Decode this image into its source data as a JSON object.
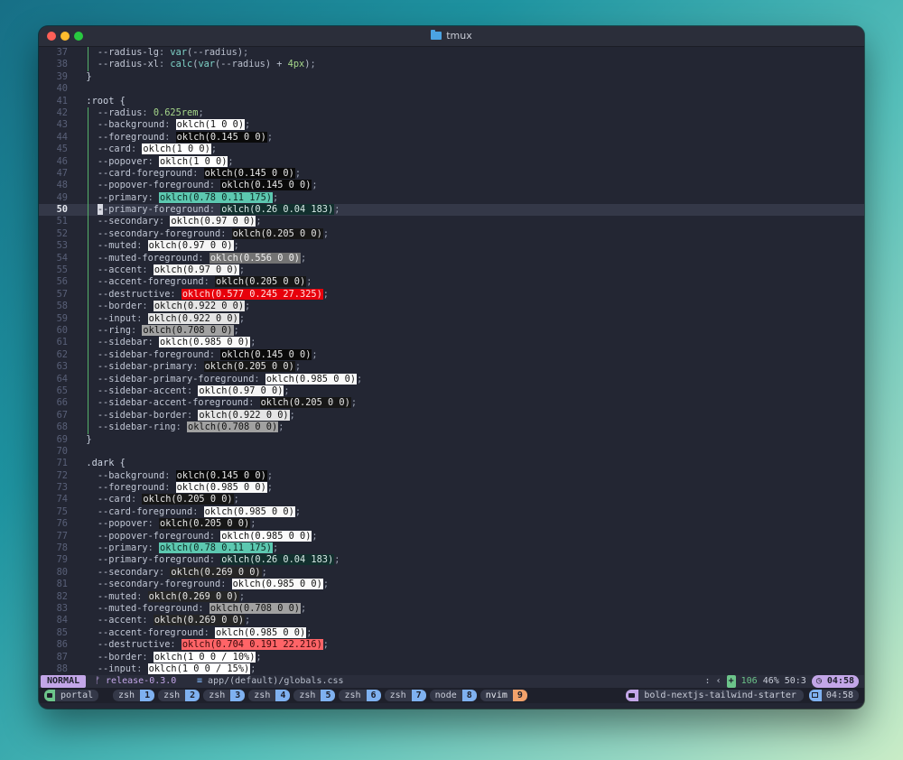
{
  "window": {
    "title": "tmux"
  },
  "editor": {
    "current_line": 50,
    "lines": [
      {
        "n": "37",
        "t": "    --radius-lg: var(--radius);",
        "g": 1
      },
      {
        "n": "38",
        "t": "    --radius-xl: calc(var(--radius) + 4px);",
        "g": 1
      },
      {
        "n": "39",
        "t": "  }",
        "g": 0
      },
      {
        "n": "40",
        "t": "",
        "g": 0
      },
      {
        "n": "41",
        "t": "  :root {",
        "g": 0
      },
      {
        "n": "42",
        "t": "    --radius: 0.625rem;",
        "g": 1
      },
      {
        "n": "43",
        "t": "    --background: oklch(1 0 0);",
        "g": 1,
        "sw": "#ffffff",
        "fg": "#111"
      },
      {
        "n": "44",
        "t": "    --foreground: oklch(0.145 0 0);",
        "g": 1,
        "sw": "#0a0a0a",
        "fg": "#e6e6e6"
      },
      {
        "n": "45",
        "t": "    --card: oklch(1 0 0);",
        "g": 1,
        "sw": "#ffffff",
        "fg": "#111"
      },
      {
        "n": "46",
        "t": "    --popover: oklch(1 0 0);",
        "g": 1,
        "sw": "#ffffff",
        "fg": "#111"
      },
      {
        "n": "47",
        "t": "    --card-foreground: oklch(0.145 0 0);",
        "g": 1,
        "sw": "#0a0a0a",
        "fg": "#e6e6e6"
      },
      {
        "n": "48",
        "t": "    --popover-foreground: oklch(0.145 0 0);",
        "g": 1,
        "sw": "#0a0a0a",
        "fg": "#e6e6e6"
      },
      {
        "n": "49",
        "t": "    --primary: oklch(0.78 0.11 175);",
        "g": 1,
        "sw": "#5cc8b0",
        "fg": "#0d2a24"
      },
      {
        "n": "50",
        "t": "    --primary-foreground: oklch(0.26 0.04 183);",
        "g": 1,
        "sw": "#12302e",
        "fg": "#d7e9e6"
      },
      {
        "n": "51",
        "t": "    --secondary: oklch(0.97 0 0);",
        "g": 1,
        "sw": "#f5f5f5",
        "fg": "#111"
      },
      {
        "n": "52",
        "t": "    --secondary-foreground: oklch(0.205 0 0);",
        "g": 1,
        "sw": "#171717",
        "fg": "#e6e6e6"
      },
      {
        "n": "53",
        "t": "    --muted: oklch(0.97 0 0);",
        "g": 1,
        "sw": "#f5f5f5",
        "fg": "#111"
      },
      {
        "n": "54",
        "t": "    --muted-foreground: oklch(0.556 0 0);",
        "g": 1,
        "sw": "#737373",
        "fg": "#f0f0f0"
      },
      {
        "n": "55",
        "t": "    --accent: oklch(0.97 0 0);",
        "g": 1,
        "sw": "#f5f5f5",
        "fg": "#111"
      },
      {
        "n": "56",
        "t": "    --accent-foreground: oklch(0.205 0 0);",
        "g": 1,
        "sw": "#171717",
        "fg": "#e6e6e6"
      },
      {
        "n": "57",
        "t": "    --destructive: oklch(0.577 0.245 27.325);",
        "g": 1,
        "sw": "#e7000b",
        "fg": "#ffe3e3"
      },
      {
        "n": "58",
        "t": "    --border: oklch(0.922 0 0);",
        "g": 1,
        "sw": "#e5e5e5",
        "fg": "#111"
      },
      {
        "n": "59",
        "t": "    --input: oklch(0.922 0 0);",
        "g": 1,
        "sw": "#e5e5e5",
        "fg": "#111"
      },
      {
        "n": "60",
        "t": "    --ring: oklch(0.708 0 0);",
        "g": 1,
        "sw": "#a1a1a1",
        "fg": "#111"
      },
      {
        "n": "61",
        "t": "    --sidebar: oklch(0.985 0 0);",
        "g": 1,
        "sw": "#fafafa",
        "fg": "#111"
      },
      {
        "n": "62",
        "t": "    --sidebar-foreground: oklch(0.145 0 0);",
        "g": 1,
        "sw": "#0a0a0a",
        "fg": "#e6e6e6"
      },
      {
        "n": "63",
        "t": "    --sidebar-primary: oklch(0.205 0 0);",
        "g": 1,
        "sw": "#171717",
        "fg": "#e6e6e6"
      },
      {
        "n": "64",
        "t": "    --sidebar-primary-foreground: oklch(0.985 0 0);",
        "g": 1,
        "sw": "#fafafa",
        "fg": "#111"
      },
      {
        "n": "65",
        "t": "    --sidebar-accent: oklch(0.97 0 0);",
        "g": 1,
        "sw": "#f5f5f5",
        "fg": "#111"
      },
      {
        "n": "66",
        "t": "    --sidebar-accent-foreground: oklch(0.205 0 0);",
        "g": 1,
        "sw": "#171717",
        "fg": "#e6e6e6"
      },
      {
        "n": "67",
        "t": "    --sidebar-border: oklch(0.922 0 0);",
        "g": 1,
        "sw": "#e5e5e5",
        "fg": "#111"
      },
      {
        "n": "68",
        "t": "    --sidebar-ring: oklch(0.708 0 0);",
        "g": 1,
        "sw": "#a1a1a1",
        "fg": "#111"
      },
      {
        "n": "69",
        "t": "  }",
        "g": 0
      },
      {
        "n": "70",
        "t": "",
        "g": 0
      },
      {
        "n": "71",
        "t": "  .dark {",
        "g": 0
      },
      {
        "n": "72",
        "t": "    --background: oklch(0.145 0 0);",
        "g": 0,
        "sw": "#0a0a0a",
        "fg": "#e6e6e6"
      },
      {
        "n": "73",
        "t": "    --foreground: oklch(0.985 0 0);",
        "g": 0,
        "sw": "#fafafa",
        "fg": "#111"
      },
      {
        "n": "74",
        "t": "    --card: oklch(0.205 0 0);",
        "g": 0,
        "sw": "#171717",
        "fg": "#e6e6e6"
      },
      {
        "n": "75",
        "t": "    --card-foreground: oklch(0.985 0 0);",
        "g": 0,
        "sw": "#fafafa",
        "fg": "#111"
      },
      {
        "n": "76",
        "t": "    --popover: oklch(0.205 0 0);",
        "g": 0,
        "sw": "#171717",
        "fg": "#e6e6e6"
      },
      {
        "n": "77",
        "t": "    --popover-foreground: oklch(0.985 0 0);",
        "g": 0,
        "sw": "#fafafa",
        "fg": "#111"
      },
      {
        "n": "78",
        "t": "    --primary: oklch(0.78 0.11 175);",
        "g": 0,
        "sw": "#5cc8b0",
        "fg": "#0d2a24"
      },
      {
        "n": "79",
        "t": "    --primary-foreground: oklch(0.26 0.04 183);",
        "g": 0,
        "sw": "#12302e",
        "fg": "#d7e9e6"
      },
      {
        "n": "80",
        "t": "    --secondary: oklch(0.269 0 0);",
        "g": 0,
        "sw": "#262626",
        "fg": "#e6e6e6"
      },
      {
        "n": "81",
        "t": "    --secondary-foreground: oklch(0.985 0 0);",
        "g": 0,
        "sw": "#fafafa",
        "fg": "#111"
      },
      {
        "n": "82",
        "t": "    --muted: oklch(0.269 0 0);",
        "g": 0,
        "sw": "#262626",
        "fg": "#e6e6e6"
      },
      {
        "n": "83",
        "t": "    --muted-foreground: oklch(0.708 0 0);",
        "g": 0,
        "sw": "#a1a1a1",
        "fg": "#111"
      },
      {
        "n": "84",
        "t": "    --accent: oklch(0.269 0 0);",
        "g": 0,
        "sw": "#262626",
        "fg": "#e6e6e6"
      },
      {
        "n": "85",
        "t": "    --accent-foreground: oklch(0.985 0 0);",
        "g": 0,
        "sw": "#fafafa",
        "fg": "#111"
      },
      {
        "n": "86",
        "t": "    --destructive: oklch(0.704 0.191 22.216);",
        "g": 0,
        "sw": "#ff6467",
        "fg": "#3a0b0c"
      },
      {
        "n": "87",
        "t": "    --border: oklch(1 0 0 / 10%);",
        "g": 0,
        "sw": "#ffffff",
        "fg": "#111"
      },
      {
        "n": "88",
        "t": "    --input: oklch(1 0 0 / 15%);",
        "g": 0,
        "sw": "#ffffff",
        "fg": "#111"
      }
    ]
  },
  "statusline": {
    "mode": "NORMAL",
    "branch": "release-0.3.0",
    "file": "app/(default)/globals.css",
    "separator": ":",
    "added_icon": "+",
    "added": "106",
    "percent": "46%",
    "position": "50:3",
    "time": "04:58"
  },
  "tmux": {
    "session": "portal",
    "windows": [
      {
        "name": "zsh",
        "num": "1"
      },
      {
        "name": "zsh",
        "num": "2"
      },
      {
        "name": "zsh",
        "num": "3"
      },
      {
        "name": "zsh",
        "num": "4"
      },
      {
        "name": "zsh",
        "num": "5"
      },
      {
        "name": "zsh",
        "num": "6"
      },
      {
        "name": "zsh",
        "num": "7"
      },
      {
        "name": "node",
        "num": "8"
      },
      {
        "name": "nvim",
        "num": "9",
        "active": true
      }
    ],
    "directory": "bold-nextjs-tailwind-starter",
    "time": "04:58"
  }
}
